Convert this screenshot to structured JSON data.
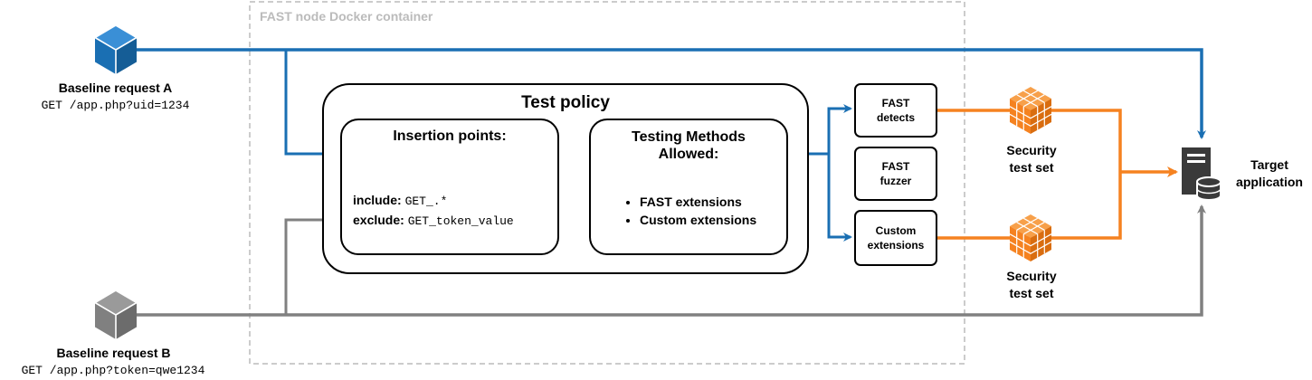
{
  "container": {
    "title": "FAST node Docker container"
  },
  "request_a": {
    "title": "Baseline request A",
    "request": "GET /app.php?uid=1234",
    "color": "#1a6fb3"
  },
  "request_b": {
    "title": "Baseline request B",
    "request": "GET /app.php?token=qwe1234",
    "color": "#808080"
  },
  "test_policy": {
    "title": "Test policy",
    "insertion_points": {
      "title": "Insertion points:",
      "include_label": "include:",
      "include_value": "GET_.*",
      "exclude_label": "exclude:",
      "exclude_value": "GET_token_value"
    },
    "testing_methods": {
      "title_line1": "Testing Methods",
      "title_line2": "Allowed:",
      "items": [
        "FAST extensions",
        "Custom extensions"
      ]
    }
  },
  "modules": {
    "detects": {
      "line1": "FAST",
      "line2": "detects"
    },
    "fuzzer": {
      "line1": "FAST",
      "line2": "fuzzer"
    },
    "custom": {
      "line1": "Custom",
      "line2": "extensions"
    }
  },
  "test_sets": [
    {
      "line1": "Security",
      "line2": "test set"
    },
    {
      "line1": "Security",
      "line2": "test set"
    }
  ],
  "target": {
    "line1": "Target",
    "line2": "application"
  },
  "colors": {
    "blue": "#1a6fb3",
    "gray": "#808080",
    "orange": "#f58220",
    "container_border": "#bbbbbb"
  }
}
